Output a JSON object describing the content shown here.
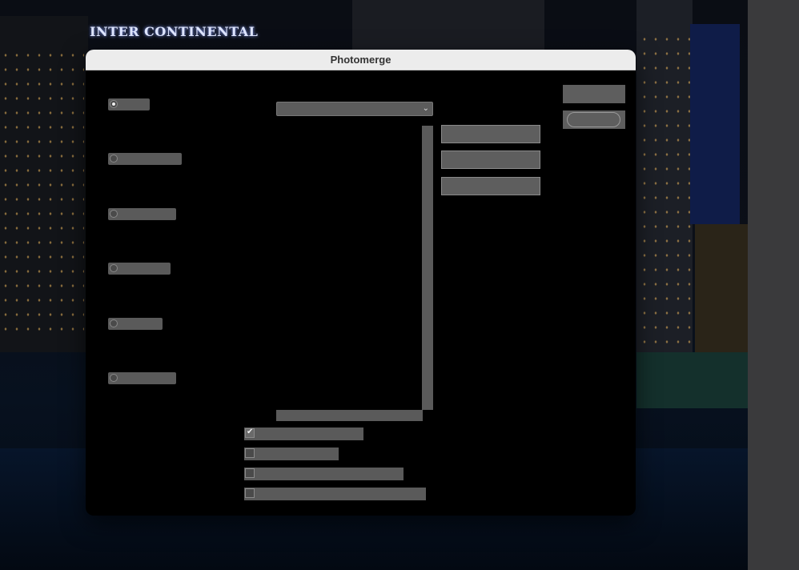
{
  "window": {
    "title": "Photomerge"
  },
  "background": {
    "sign_text": "INTER CONTINENTAL"
  },
  "layout_options": [
    {
      "label": "",
      "selected": true
    },
    {
      "label": "",
      "selected": false
    },
    {
      "label": "",
      "selected": false
    },
    {
      "label": "",
      "selected": false
    },
    {
      "label": "",
      "selected": false
    },
    {
      "label": "",
      "selected": false
    }
  ],
  "source_files": {
    "use_select_value": "",
    "browse_label": "",
    "remove_label": "",
    "add_open_label": ""
  },
  "actions": {
    "ok_label": "",
    "cancel_label": ""
  },
  "checkboxes": [
    {
      "label": "",
      "checked": true
    },
    {
      "label": "",
      "checked": false
    },
    {
      "label": "",
      "checked": false
    },
    {
      "label": "",
      "checked": false
    }
  ],
  "colors": {
    "dialog_bg": "#000000",
    "titlebar_bg": "#ececec",
    "control_gray": "#5a5a5a"
  }
}
